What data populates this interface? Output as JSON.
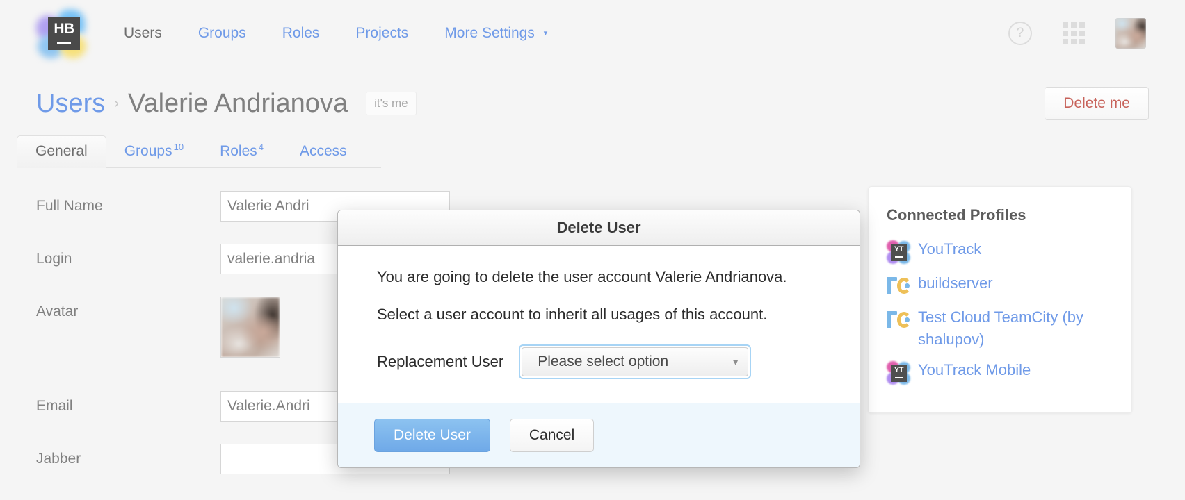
{
  "topbar": {
    "logo": {
      "text": "HB",
      "name": "hub-logo"
    },
    "nav": [
      {
        "label": "Users",
        "current": true
      },
      {
        "label": "Groups",
        "current": false
      },
      {
        "label": "Roles",
        "current": false
      },
      {
        "label": "Projects",
        "current": false
      },
      {
        "label": "More Settings",
        "current": false,
        "caret": "▾"
      }
    ],
    "help_glyph": "?",
    "icons": {
      "help": "help-icon",
      "services": "services-grid-icon",
      "avatar": "user-avatar"
    }
  },
  "page_header": {
    "breadcrumb_root": "Users",
    "breadcrumb_separator": "›",
    "title": "Valerie Andrianova",
    "its_me_badge": "it's me",
    "delete_me_label": "Delete me"
  },
  "tabs": [
    {
      "label": "General",
      "count": "",
      "active": true
    },
    {
      "label": "Groups",
      "count": "10",
      "active": false
    },
    {
      "label": "Roles",
      "count": "4",
      "active": false
    },
    {
      "label": "Access",
      "count": "",
      "active": false
    }
  ],
  "form": {
    "rows": [
      {
        "label": "Full Name",
        "value": "Valerie Andri",
        "type": "text"
      },
      {
        "label": "Login",
        "value": "valerie.andria",
        "type": "text"
      },
      {
        "label": "Avatar",
        "value": "",
        "type": "image"
      },
      {
        "label": "Email",
        "value": "Valerie.Andri",
        "type": "text"
      },
      {
        "label": "Jabber",
        "value": "",
        "type": "text"
      }
    ]
  },
  "connected_profiles": {
    "title": "Connected Profiles",
    "items": [
      {
        "label": "YouTrack",
        "icon": "youtrack-icon",
        "icon_text": "YT"
      },
      {
        "label": "buildserver",
        "icon": "teamcity-icon",
        "icon_text": ""
      },
      {
        "label": "Test Cloud TeamCity (by shalupov)",
        "icon": "teamcity-icon",
        "icon_text": ""
      },
      {
        "label": "YouTrack Mobile",
        "icon": "youtrack-icon",
        "icon_text": "YT"
      }
    ]
  },
  "modal": {
    "title": "Delete User",
    "line1": "You are going to delete the user account Valerie Andrianova.",
    "line2": "Select a user account to inherit all usages of this account.",
    "field_label": "Replacement User",
    "select_value": "Please select option",
    "select_caret": "▾",
    "confirm_label": "Delete User",
    "cancel_label": "Cancel"
  },
  "colors": {
    "link": "#6f9ae8",
    "danger": "#c7625a",
    "page_bg": "#f5f5f5",
    "primary_button": "#7bb3ec",
    "footer_bg": "#eef7fd",
    "focus_ring": "#a7d4f5"
  }
}
